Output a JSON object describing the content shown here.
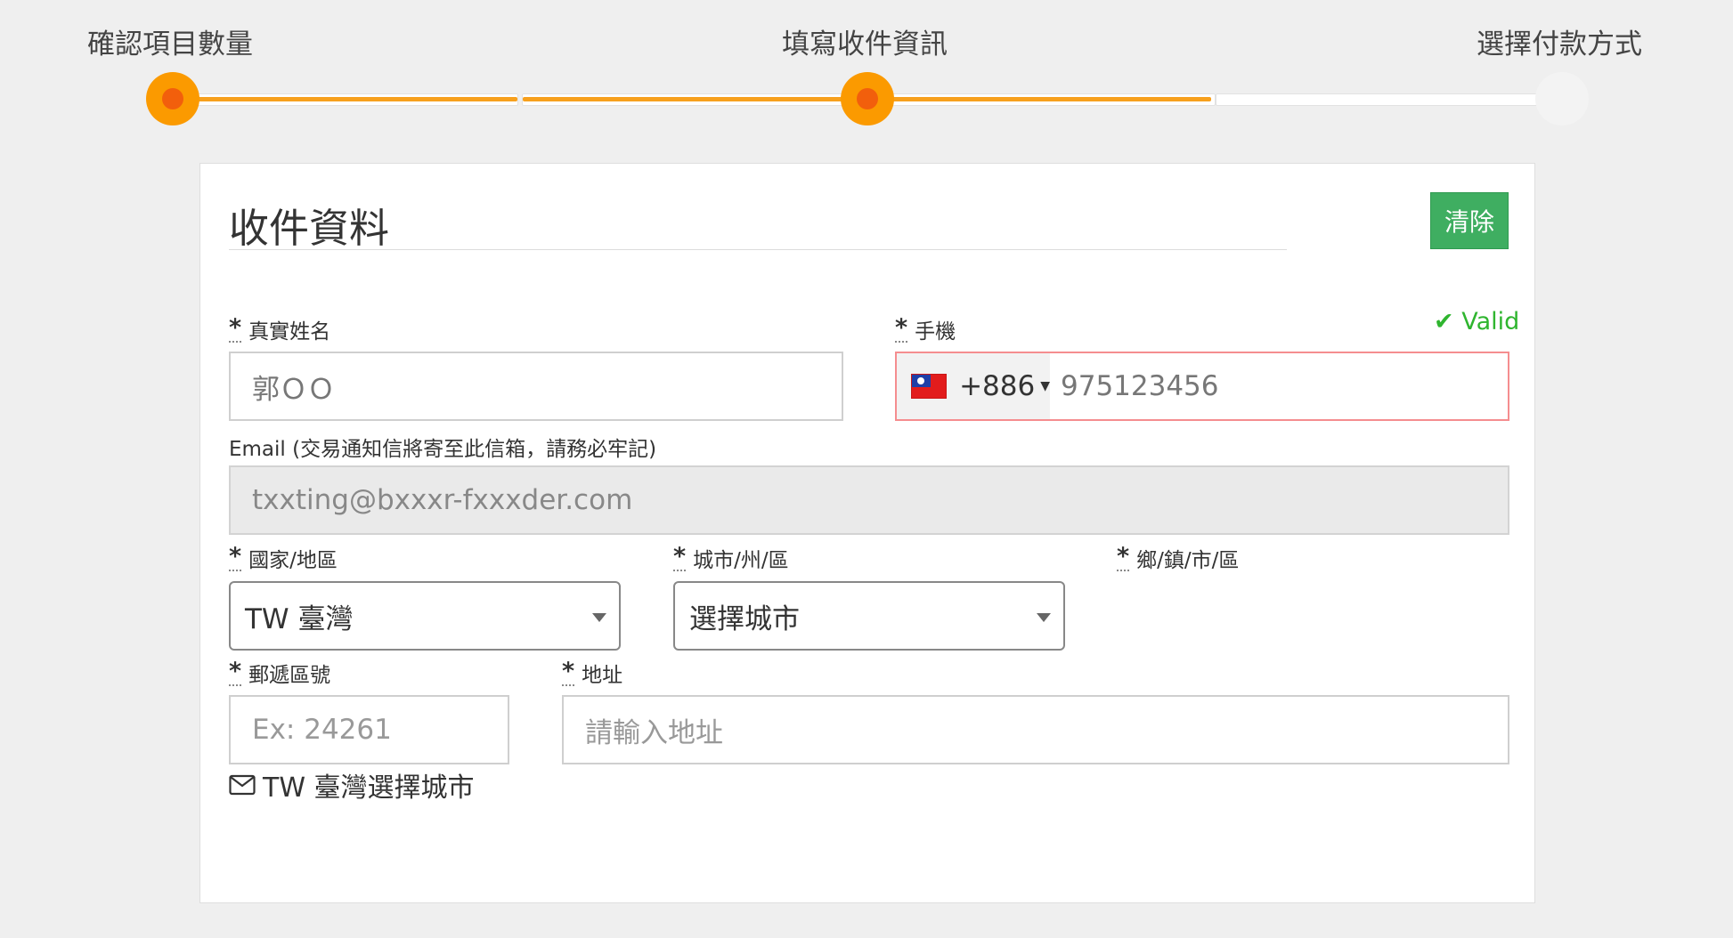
{
  "steps": [
    {
      "label": "確認項目數量",
      "state": "done"
    },
    {
      "label": "填寫收件資訊",
      "state": "current"
    },
    {
      "label": "選擇付款方式",
      "state": "pending"
    }
  ],
  "colors": {
    "accent": "#fb9a00",
    "accent_core": "#f25f0c",
    "clear_button": "#3fae61",
    "valid": "#2fb52f",
    "error_border": "#f58d8f"
  },
  "form": {
    "title": "收件資料",
    "clear_label": "清除",
    "required_mark": "*",
    "name": {
      "label": "真實姓名",
      "value": "郭ＯＯ"
    },
    "phone": {
      "label": "手機",
      "valid_label": "✔ Valid",
      "flag": "taiwan-flag-icon",
      "country_code": "+886",
      "value": "975123456"
    },
    "email": {
      "label": "Email (交易通知信將寄至此信箱，請務必牢記)",
      "value": "txxting@bxxxr-fxxxder.com"
    },
    "country": {
      "label": "國家/地區",
      "value": "TW 臺灣"
    },
    "city": {
      "label": "城市/州/區",
      "value": "選擇城市"
    },
    "district": {
      "label": "鄉/鎮/市/區"
    },
    "zip": {
      "label": "郵遞區號",
      "placeholder": "Ex: 24261"
    },
    "address": {
      "label": "地址",
      "placeholder": "請輸入地址"
    },
    "summary": {
      "icon": "envelope-icon",
      "text": "TW 臺灣選擇城市"
    }
  }
}
